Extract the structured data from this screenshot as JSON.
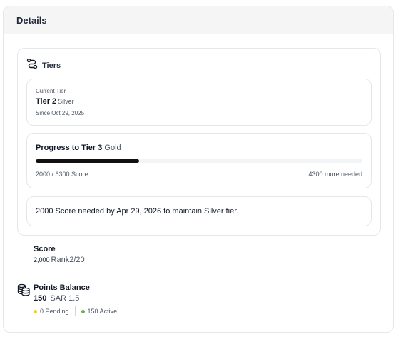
{
  "panel": {
    "title": "Details"
  },
  "tiers": {
    "label": "Tiers",
    "current": {
      "caption": "Current Tier",
      "tier": "Tier 2",
      "tier_name": "Silver",
      "since": "Since Oct 29, 2025"
    },
    "progress": {
      "title": "Progress to Tier 3",
      "target_name": "Gold",
      "current_score": 2000,
      "target_score": 6300,
      "fraction": 0.3175,
      "left_text": "2000 / 6300 Score",
      "right_text": "4300 more needed"
    },
    "note": "2000 Score needed by Apr 29, 2026 to maintain Silver tier."
  },
  "score": {
    "label": "Score",
    "value": "2,000",
    "rank": "Rank2/20"
  },
  "points": {
    "label": "Points Balance",
    "value": "150",
    "sar": "SAR 1.5",
    "pending": "0 Pending",
    "active": "150 Active"
  },
  "colors": {
    "progress_fill": "#111111",
    "pending_dot": "#facc15",
    "active_dot": "#6ab04c"
  },
  "icons": {
    "tiers": "route-icon",
    "points": "coins-stack-icon"
  }
}
